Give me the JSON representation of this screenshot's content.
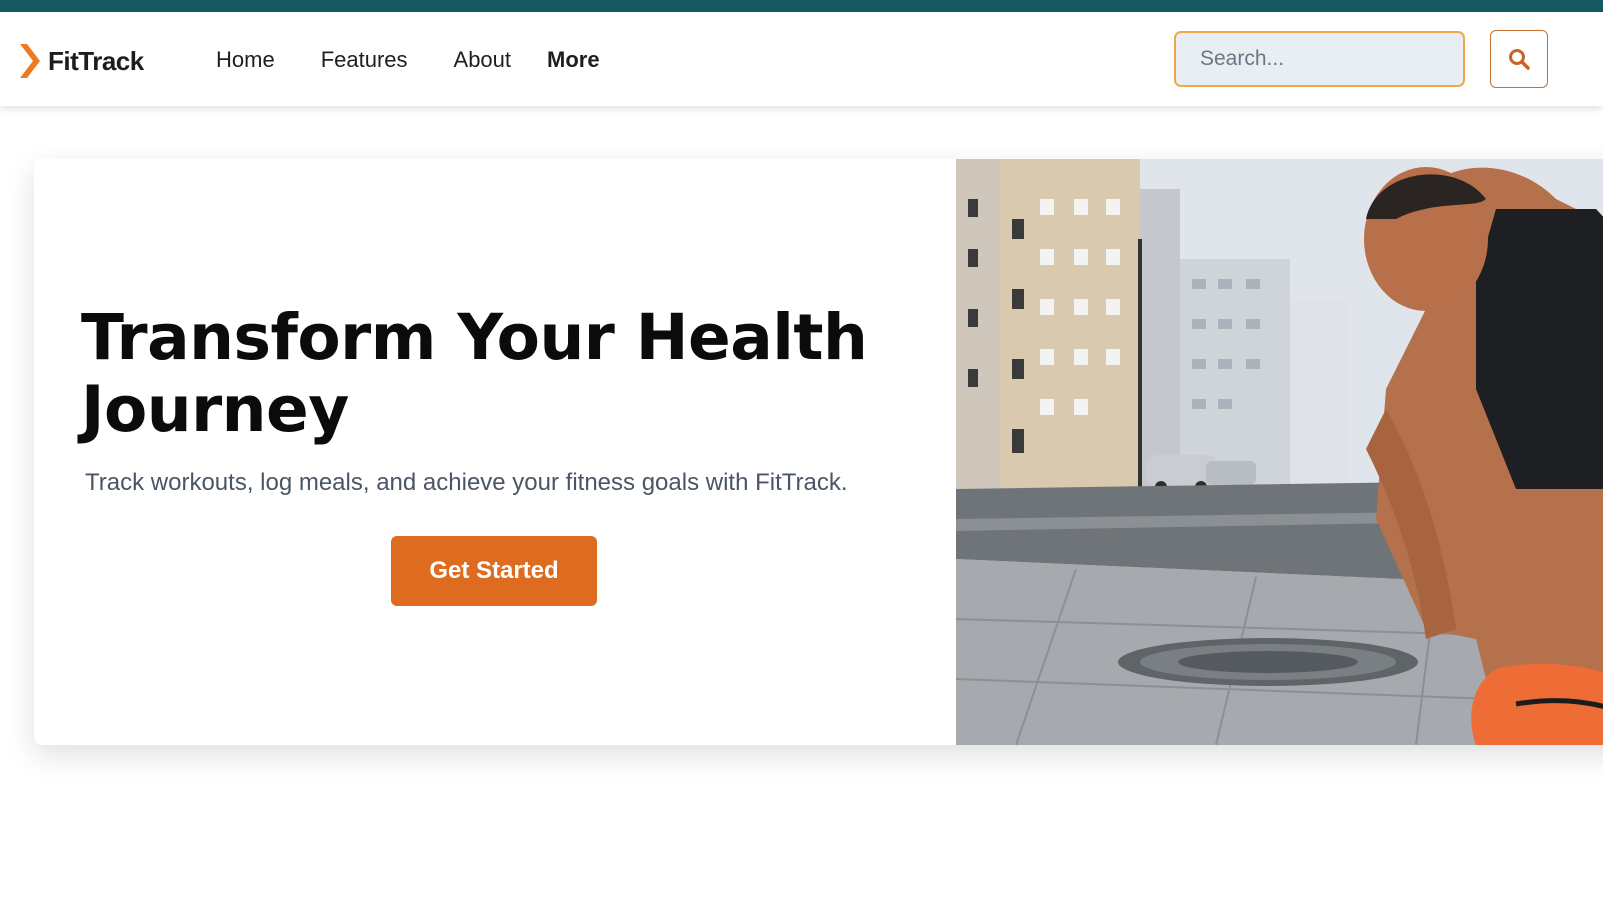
{
  "brand": {
    "name": "FitTrack",
    "logo_icon": "chevron-logo-icon",
    "accent_color": "#f07a22"
  },
  "nav": {
    "items": [
      {
        "label": "Home"
      },
      {
        "label": "Features"
      },
      {
        "label": "About"
      },
      {
        "label": "More"
      }
    ]
  },
  "search": {
    "placeholder": "Search...",
    "value": "",
    "button_icon": "search-icon"
  },
  "hero": {
    "title": "Transform Your Health Journey",
    "subtitle": "Track workouts, log meals, and achieve your fitness goals with FitTrack.",
    "cta_label": "Get Started",
    "cta_color": "#dd6b20",
    "image": "runner-tying-shoe-on-city-street"
  },
  "colors": {
    "top_stripe": "#145a63",
    "search_border": "#f0a64a",
    "search_bg": "#e9eef3"
  }
}
